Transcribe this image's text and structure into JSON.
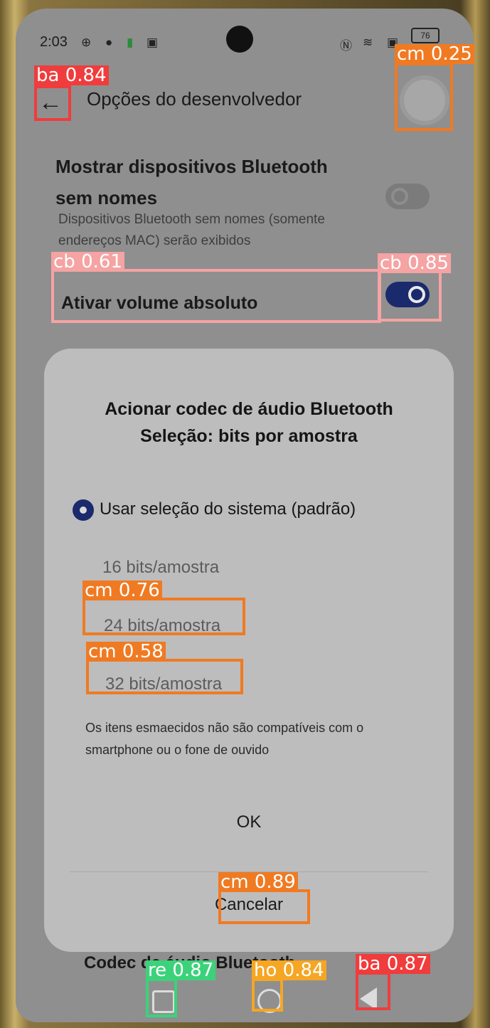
{
  "status_bar": {
    "time": "2:03",
    "battery": "76",
    "icons": [
      "steering-wheel-icon",
      "notification-icon",
      "battery-saver-icon",
      "app-icon",
      "nfc-icon",
      "wifi-icon",
      "sim-icon"
    ]
  },
  "app_bar": {
    "title": "Opções do desenvolvedor"
  },
  "settings": {
    "bt_no_names_title_line1": "Mostrar dispositivos Bluetooth",
    "bt_no_names_title_line2": "sem nomes",
    "bt_no_names_desc_line1": "Dispositivos Bluetooth sem nomes (somente",
    "bt_no_names_desc_line2": "endereços MAC) serão exibidos",
    "bt_no_names_enabled": false,
    "absolute_volume_title": "Ativar volume absoluto",
    "absolute_volume_enabled": true,
    "behind_dialog_text": "Codec de áudio Bluetooth"
  },
  "dialog": {
    "title_line1": "Acionar codec de áudio Bluetooth",
    "title_line2": "Seleção: bits por amostra",
    "selected_option": "Usar seleção do sistema (padrão)",
    "options": [
      "Usar seleção do sistema (padrão)",
      "16 bits/amostra",
      "24 bits/amostra",
      "32 bits/amostra"
    ],
    "note_line1": "Os itens esmaecidos não são compatíveis com o",
    "note_line2": "smartphone ou o fone de ouvido",
    "ok_label": "OK",
    "cancel_label": "Cancelar"
  },
  "detections": [
    {
      "label": "ba 0.84",
      "color": "#f03c3c"
    },
    {
      "label": "cm 0.25",
      "color": "#f07a22"
    },
    {
      "label": "cb 0.61",
      "color": "#f5a3a3"
    },
    {
      "label": "cb 0.85",
      "color": "#f5a3a3"
    },
    {
      "label": "cm 0.76",
      "color": "#f07a22"
    },
    {
      "label": "cm 0.58",
      "color": "#f07a22"
    },
    {
      "label": "cm 0.89",
      "color": "#f07a22"
    },
    {
      "label": "re 0.87",
      "color": "#3cd27a"
    },
    {
      "label": "ho 0.84",
      "color": "#f5a623"
    },
    {
      "label": "ba 0.87",
      "color": "#f03c3c"
    }
  ]
}
